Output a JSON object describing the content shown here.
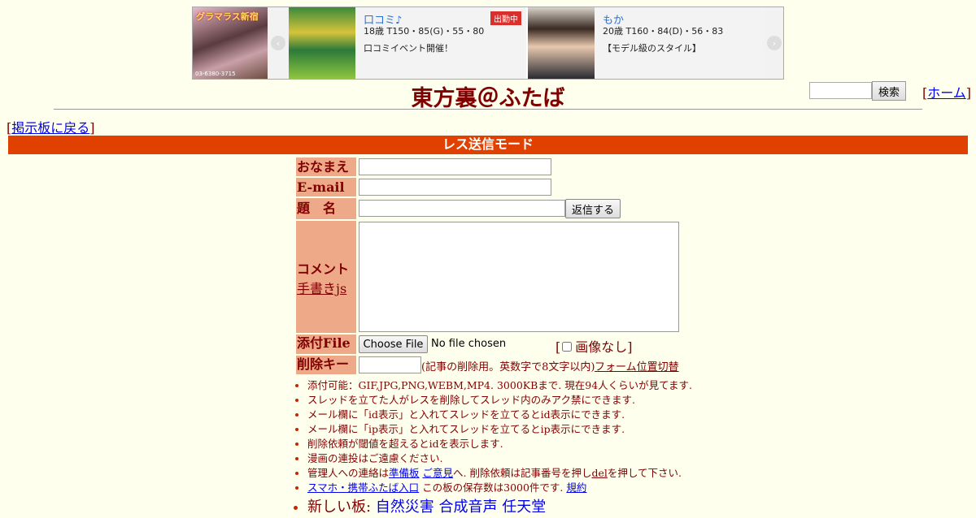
{
  "ad": {
    "left_banner_title": "グラマラス新宿",
    "left_banner_tel": "03-6380-3715",
    "prev_arrow": "‹",
    "next_arrow": "›",
    "cards": [
      {
        "name": "口コミ♪",
        "stats": "18歳 T150・85(G)・55・80",
        "pr": "口コミイベント開催！",
        "badge": "出勤中"
      },
      {
        "name": "もか",
        "stats": "20歳 T160・84(D)・56・83",
        "pr": "【モデル級のスタイル】"
      }
    ]
  },
  "header": {
    "title": "東方裏＠ふたば",
    "search_button": "検索",
    "home_open": "[",
    "home_link": "ホーム",
    "home_close": "]"
  },
  "nav": {
    "back_open": "[",
    "back_link": "掲示板に戻る",
    "back_close": "]"
  },
  "mode_banner": "レス送信モード",
  "form": {
    "name_label": "おなまえ",
    "email_label": "E-mail",
    "subject_label": "題　名",
    "submit_label": "返信する",
    "comment_label": "コメント",
    "handwriting_link": "手書きjs",
    "file_label": "添付File",
    "choose_file": "Choose File",
    "no_file": "No file chosen",
    "no_image_open": "[",
    "no_image_label": "画像なし",
    "no_image_close": "]",
    "delkey_label": "削除キー",
    "delkey_note": "(記事の削除用。英数字で8文字以内)",
    "form_pos_link": "フォーム位置切替"
  },
  "notes": {
    "n1": "添付可能：GIF,JPG,PNG,WEBM,MP4. 3000KBまで. 現在94人くらいが見てます.",
    "n2": "スレッドを立てた人がレスを削除してスレッド内のみアク禁にできます.",
    "n3": "メール欄に「id表示」と入れてスレッドを立てるとid表示にできます.",
    "n4": "メール欄に「ip表示」と入れてスレッドを立てるとip表示にできます.",
    "n5": "削除依頼が閾値を超えるとidを表示します.",
    "n6": "漫画の連投はご遠慮ください.",
    "n7_a": "管理人への連絡は",
    "n7_link1": "準備板",
    "n7_link2": "ご意見",
    "n7_b": "へ. 削除依頼は記事番号を押し",
    "n7_link3": "del",
    "n7_c": "を押して下さい.",
    "n8_link1": "スマホ・携帯ふたば入口",
    "n8_b": " この板の保存数は3000件です. ",
    "n8_link2": "規約",
    "n9_a": "新しい板: ",
    "n9_boards": [
      "自然災害",
      "合成音声",
      "任天堂"
    ]
  }
}
